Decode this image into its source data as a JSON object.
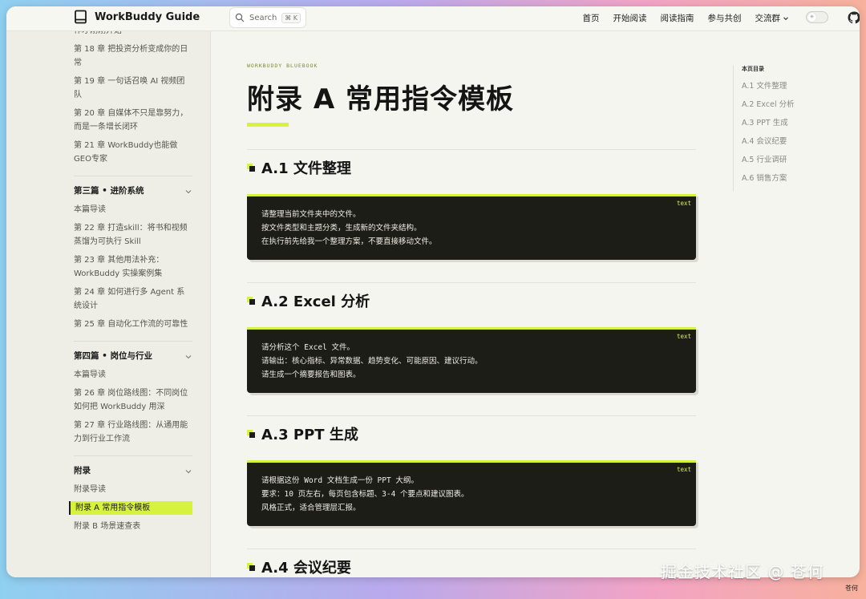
{
  "brand": {
    "name": "WorkBuddy Guide",
    "icon": "book-icon"
  },
  "search": {
    "label": "Search",
    "shortcut": "⌘ K"
  },
  "nav": {
    "links": [
      "首页",
      "开始阅读",
      "阅读指南",
      "参与共创"
    ],
    "dropdown": "交流群",
    "theme_toggle_icon": "sun-icon",
    "github_icon": "github-icon"
  },
  "sidebar": {
    "top_cut": "作才刚刚开始",
    "top_items": [
      "第 18 章 把投资分析变成你的日常",
      "第 19 章 一句话召唤 AI 视频团队",
      "第 20 章 自媒体不只是靠努力，而是一条增长闭环",
      "第 21 章 WorkBuddy也能做GEO专家"
    ],
    "sections": [
      {
        "title": "第三篇 • 进阶系统",
        "items": [
          "本篇导读",
          "第 22 章 打造skill：将书和视频蒸馏为可执行 Skill",
          "第 23 章 其他用法补充：WorkBuddy 实操案例集",
          "第 24 章 如何进行多 Agent 系统设计",
          "第 25 章 自动化工作流的可靠性"
        ]
      },
      {
        "title": "第四篇 • 岗位与行业",
        "items": [
          "本篇导读",
          "第 26 章 岗位路线图：不同岗位如何把 WorkBuddy 用深",
          "第 27 章 行业路线图：从通用能力到行业工作流"
        ]
      },
      {
        "title": "附录",
        "items": [
          "附录导读",
          "附录 A 常用指令模板",
          "附录 B 场景速查表"
        ],
        "active": "附录 A 常用指令模板"
      }
    ]
  },
  "main": {
    "kicker": "WORKBUDDY BLUEBOOK",
    "title": "附录 A 常用指令模板",
    "sections": [
      {
        "title": "A.1 文件整理",
        "lang": "text",
        "lines": [
          "请整理当前文件夹中的文件。",
          "按文件类型和主题分类，生成新的文件夹结构。",
          "在执行前先给我一个整理方案，不要直接移动文件。"
        ]
      },
      {
        "title": "A.2 Excel 分析",
        "lang": "text",
        "lines": [
          "请分析这个 Excel 文件。",
          "请输出：核心指标、异常数据、趋势变化、可能原因、建议行动。",
          "请生成一个摘要报告和图表。"
        ]
      },
      {
        "title": "A.3 PPT 生成",
        "lang": "text",
        "lines": [
          "请根据这份 Word 文档生成一份 PPT 大纲。",
          "要求：10 页左右，每页包含标题、3-4 个要点和建议图表。",
          "风格正式，适合管理层汇报。"
        ]
      },
      {
        "title": "A.4 会议纪要",
        "lang": "",
        "lines": []
      }
    ]
  },
  "toc": {
    "title": "本页目录",
    "items": [
      "A.1 文件整理",
      "A.2 Excel 分析",
      "A.3 PPT 生成",
      "A.4 会议纪要",
      "A.5 行业调研",
      "A.6 销售方案"
    ]
  },
  "watermark": {
    "main": "掘金技术社区 @ 苍何",
    "small": "苍何"
  },
  "colors": {
    "accent": "#d7f23d",
    "code_bg": "#1d1d18",
    "sidebar_bg": "#eeeee6",
    "page_bg": "#f5f5ef"
  }
}
